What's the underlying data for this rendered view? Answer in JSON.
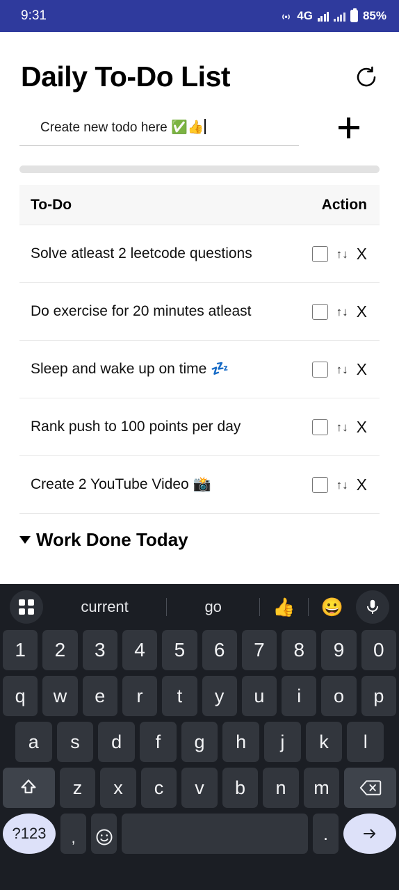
{
  "status_bar": {
    "time": "9:31",
    "network_label": "4G",
    "battery_percent": "85%",
    "icons": [
      "hotspot-icon",
      "signal-bars-icon",
      "signal-bars-secondary-icon",
      "battery-icon"
    ],
    "background_color": "#2f3a9d"
  },
  "header": {
    "title": "Daily To-Do List",
    "reset_icon": "reset-circular-arrow-icon"
  },
  "new_todo": {
    "value": "Create new todo here ✅👍",
    "placeholder": "Create new todo here",
    "add_button_label": "+",
    "add_icon": "plus-icon"
  },
  "table": {
    "columns": [
      "To-Do",
      "Action"
    ],
    "rows": [
      {
        "text": "Solve atleast 2 leetcode questions",
        "checked": false,
        "move_icon": "↑↓",
        "delete_label": "X"
      },
      {
        "text": "Do exercise for 20 minutes atleast",
        "checked": false,
        "move_icon": "↑↓",
        "delete_label": "X"
      },
      {
        "text": "Sleep and wake up on time 💤",
        "checked": false,
        "move_icon": "↑↓",
        "delete_label": "X"
      },
      {
        "text": "Rank push to 100 points per day",
        "checked": false,
        "move_icon": "↑↓",
        "delete_label": "X"
      },
      {
        "text": "Create 2 YouTube Video 📸",
        "checked": false,
        "move_icon": "↑↓",
        "delete_label": "X"
      }
    ]
  },
  "section": {
    "work_done_today": "Work Done Today"
  },
  "keyboard": {
    "suggestions": {
      "grid_icon": "grid-menu-icon",
      "word_left": "current",
      "word_right": "go",
      "emoji_thumbs": "👍",
      "emoji_smile": "😀",
      "mic_icon": "microphone-icon"
    },
    "row_numbers": [
      "1",
      "2",
      "3",
      "4",
      "5",
      "6",
      "7",
      "8",
      "9",
      "0"
    ],
    "row_top": [
      "q",
      "w",
      "e",
      "r",
      "t",
      "y",
      "u",
      "i",
      "o",
      "p"
    ],
    "row_home": [
      "a",
      "s",
      "d",
      "f",
      "g",
      "h",
      "j",
      "k",
      "l"
    ],
    "row_bottom": [
      "z",
      "x",
      "c",
      "v",
      "b",
      "n",
      "m"
    ],
    "shift_icon": "shift-arrow-icon",
    "backspace_icon": "backspace-icon",
    "symbols_key": "?123",
    "comma_key": ",",
    "emoji_key_icon": "emoji-face-icon",
    "space_key": "",
    "period_key": ".",
    "enter_icon": "enter-arrow-icon",
    "accent_color": "#dde1f9",
    "background_color": "#1b1e24"
  }
}
